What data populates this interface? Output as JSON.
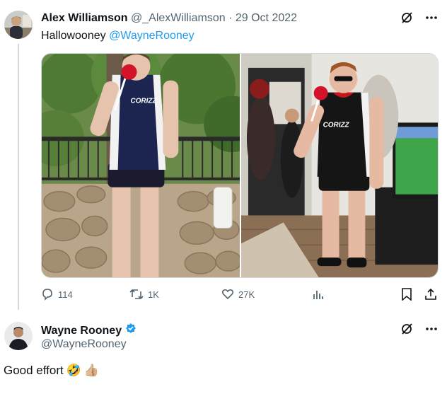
{
  "tweet": {
    "author_name": "Alex Williamson",
    "handle": "@_AlexWilliamson",
    "separator": "·",
    "date": "29 Oct 2022",
    "text_prefix": "Hallowooney ",
    "mention": "@WayneRooney",
    "icons": {
      "grok": "grok-slash-icon",
      "more": "more-dots-icon"
    },
    "actions": {
      "replies": "114",
      "retweets": "1K",
      "likes": "27K",
      "views_icon": "views-chart-icon",
      "bookmark_icon": "bookmark-icon",
      "share_icon": "share-icon"
    },
    "media": {
      "photo_left_shirt_print": "CORIZZ",
      "photo_right_shirt_print": "CORIZZ"
    }
  },
  "reply": {
    "author_name": "Wayne Rooney",
    "handle": "@WayneRooney",
    "verified_icon": "verified-badge-icon",
    "text": "Good effort",
    "emoji_1": "🤣",
    "emoji_2": "👍🏼"
  },
  "colors": {
    "accent": "#1d9bf0",
    "muted": "#536471",
    "text": "#0f1419",
    "divider": "#cfd9de"
  }
}
